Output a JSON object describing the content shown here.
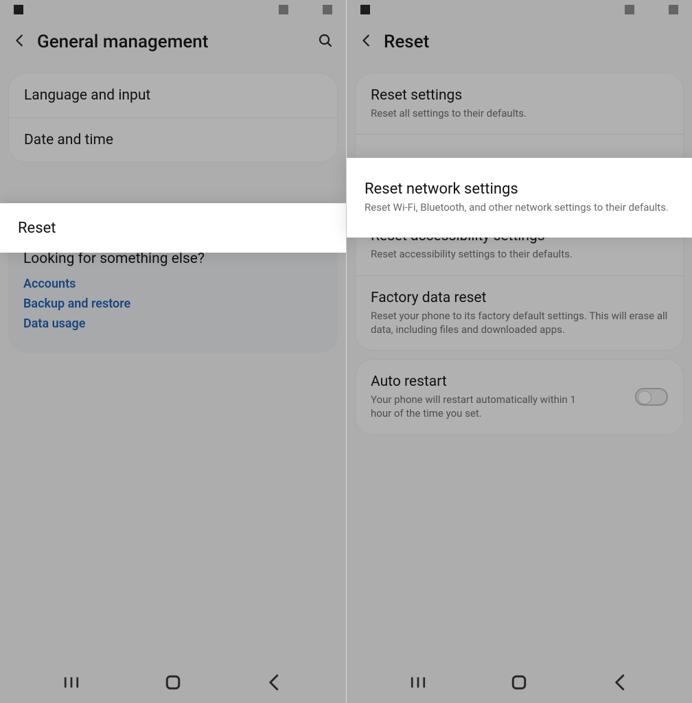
{
  "left": {
    "header_title": "General management",
    "items": {
      "language_and_input": "Language and input",
      "date_and_time": "Date and time",
      "reset": "Reset"
    },
    "looking": {
      "title": "Looking for something else?",
      "links": {
        "accounts": "Accounts",
        "backup_and_restore": "Backup and restore",
        "data_usage": "Data usage"
      }
    }
  },
  "right": {
    "header_title": "Reset",
    "items": {
      "reset_settings": {
        "title": "Reset settings",
        "sub": "Reset all settings to their defaults."
      },
      "reset_network": {
        "title": "Reset network settings",
        "sub": "Reset Wi-Fi, Bluetooth, and other network settings to their defaults."
      },
      "reset_accessibility": {
        "title": "Reset accessibility settings",
        "sub": "Reset accessibility settings to their defaults."
      },
      "factory_reset": {
        "title": "Factory data reset",
        "sub": "Reset your phone to its factory default settings. This will erase all data, including files and downloaded apps."
      },
      "auto_restart": {
        "title": "Auto restart",
        "sub": "Your phone will restart automatically within 1 hour of the time you set."
      }
    }
  }
}
